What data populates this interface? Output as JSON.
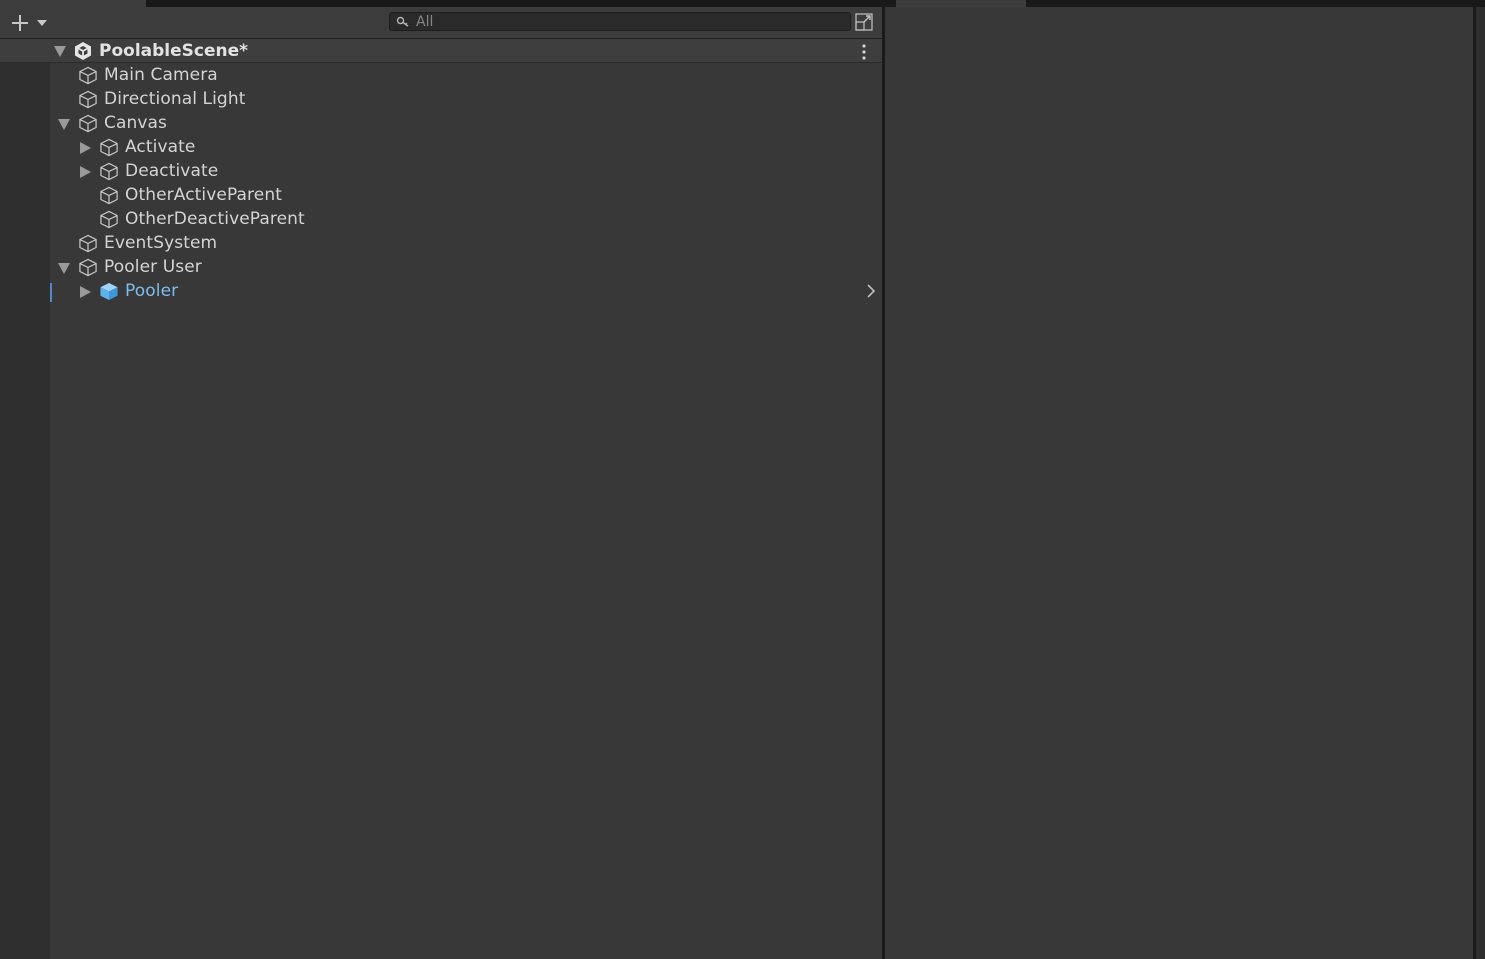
{
  "toolbar": {
    "add_icon": "plus-icon",
    "dropdown_icon": "caret-down-icon",
    "search_placeholder": "All",
    "search_value": "",
    "search_icon": "search-icon",
    "expand_icon": "expand-window-icon"
  },
  "scene": {
    "name": "PoolableScene*",
    "icon": "unity-logo-icon",
    "menu_icon": "vertical-ellipsis-icon"
  },
  "hierarchy": [
    {
      "label": "Main Camera",
      "depth": 1,
      "foldout": "none",
      "kind": "gameobject"
    },
    {
      "label": "Directional Light",
      "depth": 1,
      "foldout": "none",
      "kind": "gameobject"
    },
    {
      "label": "Canvas",
      "depth": 1,
      "foldout": "expanded",
      "kind": "gameobject"
    },
    {
      "label": "Activate",
      "depth": 2,
      "foldout": "collapsed",
      "kind": "gameobject"
    },
    {
      "label": "Deactivate",
      "depth": 2,
      "foldout": "collapsed",
      "kind": "gameobject"
    },
    {
      "label": "OtherActiveParent",
      "depth": 2,
      "foldout": "none",
      "kind": "gameobject"
    },
    {
      "label": "OtherDeactiveParent",
      "depth": 2,
      "foldout": "none",
      "kind": "gameobject"
    },
    {
      "label": "EventSystem",
      "depth": 1,
      "foldout": "none",
      "kind": "gameobject"
    },
    {
      "label": "Pooler User",
      "depth": 1,
      "foldout": "expanded",
      "kind": "gameobject"
    },
    {
      "label": "Pooler",
      "depth": 2,
      "foldout": "collapsed",
      "kind": "prefab",
      "selected": true
    }
  ],
  "colors": {
    "background": "#383838",
    "gutter": "#2f2f2f",
    "prefab_text": "#7ebdee",
    "prefab_icon": "#5fb1ec",
    "selection_marker": "#4f8bc9",
    "text": "#d4d4d4"
  }
}
